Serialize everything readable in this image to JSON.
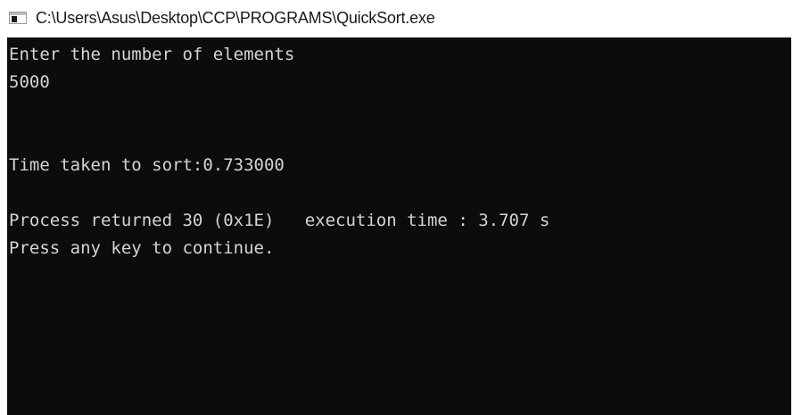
{
  "window": {
    "title": "C:\\Users\\Asus\\Desktop\\CCP\\PROGRAMS\\QuickSort.exe",
    "icon": "console-window-icon"
  },
  "console": {
    "lines": [
      "Enter the number of elements",
      "5000",
      "",
      "",
      "Time taken to sort:0.733000",
      "",
      "Process returned 30 (0x1E)   execution time : 3.707 s",
      "Press any key to continue."
    ],
    "background": "#0c0c0c",
    "foreground": "#d4d4d4"
  }
}
